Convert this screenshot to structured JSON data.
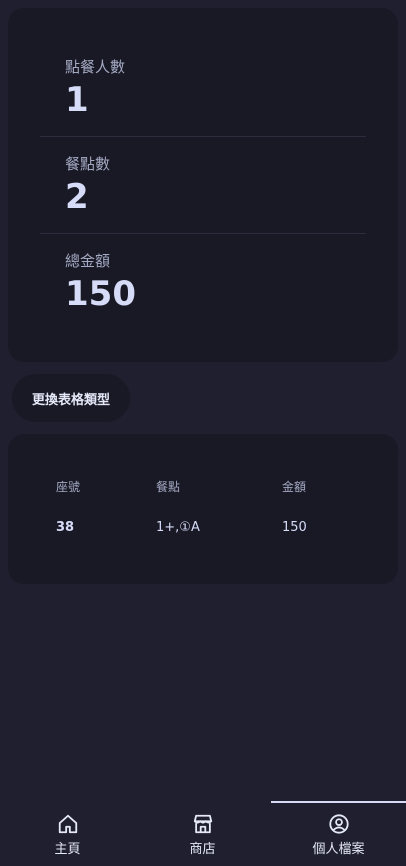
{
  "stats": {
    "diners_label": "點餐人數",
    "diners_value": "1",
    "items_label": "餐點數",
    "items_value": "2",
    "total_label": "總金額",
    "total_value": "150"
  },
  "switch_table_button": "更換表格類型",
  "table": {
    "headers": [
      "座號",
      "餐點",
      "金額"
    ],
    "rows": [
      [
        "38",
        "1+,①A",
        "150"
      ]
    ]
  },
  "bottom_nav": {
    "items": [
      {
        "label": "主頁",
        "icon": "home-icon"
      },
      {
        "label": "商店",
        "icon": "store-icon"
      },
      {
        "label": "個人檔案",
        "icon": "user-circle-icon",
        "active": true
      }
    ]
  },
  "colors": {
    "background": "#1f1f2f",
    "card": "#191925",
    "text": "#d6dcf8",
    "muted": "#a3a9c2"
  }
}
